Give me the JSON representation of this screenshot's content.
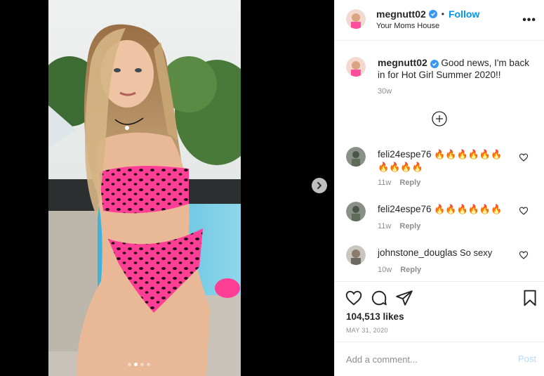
{
  "post": {
    "username": "megnutt02",
    "location": "Your Moms House",
    "follow_label": "Follow",
    "bullet": "•",
    "more_label": "•••",
    "caption_text": " Good news, I'm back in for Hot Girl Summer 2020!!",
    "caption_time": "30w",
    "likes": "104,513 likes",
    "date": "MAY 31, 2020"
  },
  "comments": [
    {
      "username": "feli24espe76",
      "text": " 🔥🔥🔥🔥🔥🔥🔥🔥🔥🔥",
      "time": "11w",
      "reply_label": "Reply"
    },
    {
      "username": "feli24espe76",
      "text": " 🔥🔥🔥🔥🔥🔥",
      "time": "11w",
      "reply_label": "Reply"
    },
    {
      "username": "johnstone_douglas",
      "text": " So sexy",
      "time": "10w",
      "reply_label": "Reply"
    }
  ],
  "add_comment": {
    "placeholder": "Add a comment...",
    "post_label": "Post"
  },
  "colors": {
    "accent": "#0095f6",
    "verified": "#3897f0",
    "muted": "#8e8e8e",
    "post_disabled": "#b3dbff"
  },
  "icons": [
    "verified-icon",
    "more-icon",
    "plus-circle-icon",
    "heart-icon",
    "comment-icon",
    "share-icon",
    "bookmark-icon",
    "next-arrow-icon"
  ]
}
